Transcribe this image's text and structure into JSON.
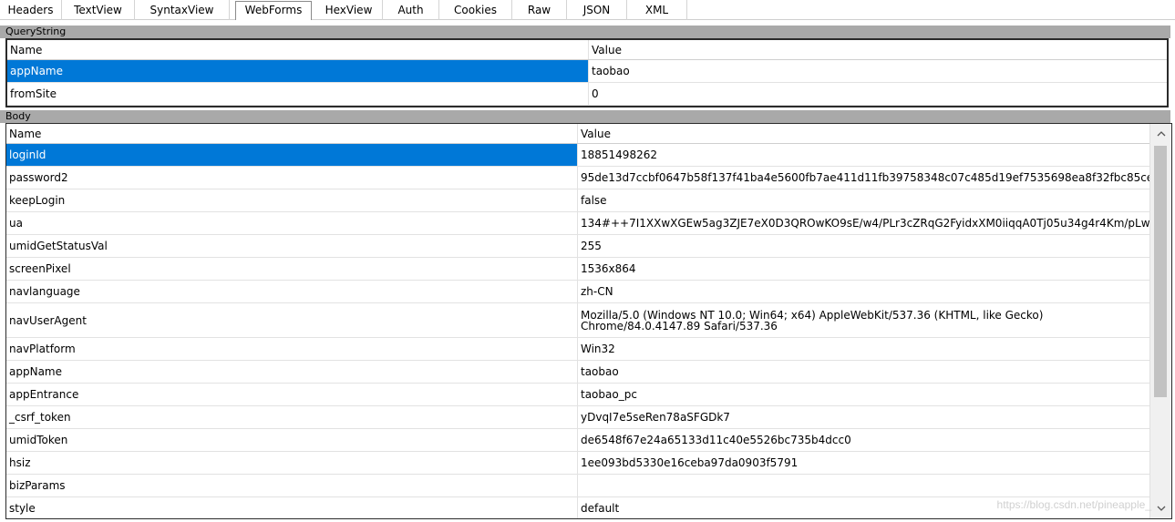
{
  "tabs": [
    {
      "label": "Headers"
    },
    {
      "label": "TextView"
    },
    {
      "label": "SyntaxView"
    },
    {
      "label": "WebForms",
      "active": true
    },
    {
      "label": "HexView"
    },
    {
      "label": "Auth"
    },
    {
      "label": "Cookies"
    },
    {
      "label": "Raw"
    },
    {
      "label": "JSON"
    },
    {
      "label": "XML"
    }
  ],
  "querystring": {
    "title": "QueryString",
    "columns": {
      "name": "Name",
      "value": "Value"
    },
    "rows": [
      {
        "name": "appName",
        "value": "taobao",
        "selected": true
      },
      {
        "name": "fromSite",
        "value": "0"
      }
    ]
  },
  "body": {
    "title": "Body",
    "columns": {
      "name": "Name",
      "value": "Value"
    },
    "rows": [
      {
        "name": "loginId",
        "value": "18851498262",
        "selected": true
      },
      {
        "name": "password2",
        "value": "95de13d7ccbf0647b58f137f41ba4e5600fb7ae411d11fb39758348c07c485d19ef7535698ea8f32fbc85ce"
      },
      {
        "name": "keepLogin",
        "value": "false"
      },
      {
        "name": "ua",
        "value": "134#++7I1XXwXGEw5ag3ZJE7eX0D3QROwKO9sE/w4/PLr3cZRqG2FyidxXM0iiqqA0Tj05u34g4r4Km/pLw"
      },
      {
        "name": "umidGetStatusVal",
        "value": "255"
      },
      {
        "name": "screenPixel",
        "value": "1536x864"
      },
      {
        "name": "navlanguage",
        "value": "zh-CN"
      },
      {
        "name": "navUserAgent",
        "value": "Mozilla/5.0 (Windows NT 10.0; Win64; x64) AppleWebKit/537.36 (KHTML, like Gecko) Chrome/84.0.4147.89 Safari/537.36",
        "multiline": true
      },
      {
        "name": "navPlatform",
        "value": "Win32"
      },
      {
        "name": "appName",
        "value": "taobao"
      },
      {
        "name": "appEntrance",
        "value": "taobao_pc"
      },
      {
        "name": "_csrf_token",
        "value": "yDvqI7e5seRen78aSFGDk7"
      },
      {
        "name": "umidToken",
        "value": "de6548f67e24a65133d11c40e5526bc735b4dcc0"
      },
      {
        "name": "hsiz",
        "value": "1ee093bd5330e16ceba97da0903f5791"
      },
      {
        "name": "bizParams",
        "value": ""
      },
      {
        "name": "style",
        "value": "default"
      }
    ]
  },
  "watermark": "https://blog.csdn.net/pineapple_",
  "colors": {
    "selection": "#0078d7",
    "section_header": "#a9a9a9"
  },
  "icons": {
    "scroll_up": "chevron-up-icon",
    "scroll_down": "chevron-down-icon"
  }
}
